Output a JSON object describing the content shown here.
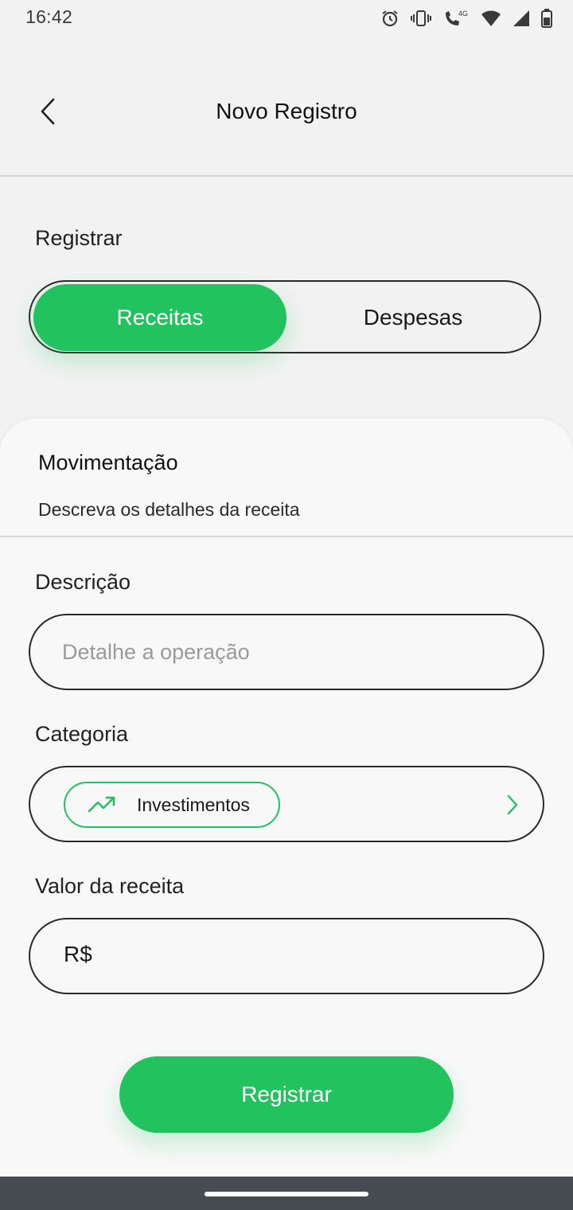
{
  "status_bar": {
    "time": "16:42",
    "icons": [
      "alarm-icon",
      "vibrate-icon",
      "wifi-calling-icon",
      "network-4g-icon",
      "wifi-icon",
      "cellular-signal-icon",
      "battery-icon"
    ],
    "network_label": "4G"
  },
  "header": {
    "title": "Novo Registro",
    "back_icon": "chevron-left-icon"
  },
  "register": {
    "label": "Registrar",
    "options": [
      "Receitas",
      "Despesas"
    ],
    "selected": "Receitas"
  },
  "card": {
    "title": "Movimentação",
    "subtitle": "Descreva os detalhes da receita"
  },
  "description": {
    "label": "Descrição",
    "placeholder": "Detalhe a operação",
    "value": ""
  },
  "category": {
    "label": "Categoria",
    "selected": "Investimentos",
    "icon": "trending-up-icon",
    "chevron_icon": "chevron-right-icon"
  },
  "amount": {
    "label": "Valor da receita",
    "currency": "R$",
    "value": ""
  },
  "submit": {
    "label": "Registrar"
  },
  "colors": {
    "accent": "#22c25e",
    "background": "#f2f2f2",
    "card": "#f8f8f8",
    "border": "#2a2a2a",
    "nav_bar": "#464c52"
  }
}
